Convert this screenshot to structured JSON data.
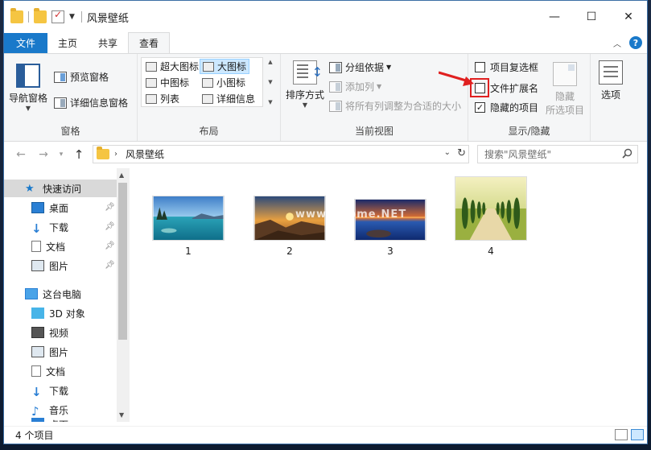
{
  "window": {
    "title": "风景壁纸",
    "controls": [
      "—",
      "☐",
      "✕"
    ]
  },
  "tabs": [
    {
      "label": "文件"
    },
    {
      "label": "主页"
    },
    {
      "label": "共享"
    },
    {
      "label": "查看"
    }
  ],
  "ribbon": {
    "panes": {
      "nav_pane": "导航窗格",
      "preview_pane": "预览窗格",
      "details_pane": "详细信息窗格",
      "group_label": "窗格"
    },
    "layout": {
      "items": [
        "超大图标",
        "大图标",
        "中图标",
        "小图标",
        "列表",
        "详细信息"
      ],
      "selected": "大图标",
      "group_label": "布局"
    },
    "current_view": {
      "sort_by": "排序方式",
      "group_by": "分组依据",
      "add_column": "添加列",
      "fit_columns": "将所有列调整为合适的大小",
      "group_label": "当前视图"
    },
    "show_hide": {
      "item_checkboxes": "项目复选框",
      "item_checkboxes_checked": false,
      "file_extensions": "文件扩展名",
      "file_extensions_checked": false,
      "hidden_items": "隐藏的项目",
      "hidden_items_checked": true,
      "hide_selected_line1": "隐藏",
      "hide_selected_line2": "所选项目",
      "group_label": "显示/隐藏"
    },
    "options": {
      "label": "选项"
    }
  },
  "address": {
    "path": "风景壁纸",
    "search_placeholder": "搜索\"风景壁纸\""
  },
  "nav_pane": {
    "quick_access": "快速访问",
    "quick_items": [
      {
        "label": "桌面",
        "pinned": true
      },
      {
        "label": "下载",
        "pinned": true
      },
      {
        "label": "文档",
        "pinned": true
      },
      {
        "label": "图片",
        "pinned": true
      }
    ],
    "this_pc": "这台电脑",
    "pc_items": [
      {
        "label": "3D 对象"
      },
      {
        "label": "视频"
      },
      {
        "label": "图片"
      },
      {
        "label": "文档"
      },
      {
        "label": "下载"
      },
      {
        "label": "音乐"
      },
      {
        "label": "桌面"
      }
    ]
  },
  "files": [
    {
      "name": "1",
      "theme": "lake"
    },
    {
      "name": "2",
      "theme": "sunset"
    },
    {
      "name": "3",
      "theme": "dusk-lake"
    },
    {
      "name": "4",
      "theme": "cypress-road"
    }
  ],
  "status": {
    "count": "4 个项目"
  },
  "watermark": "www.pHome.NET",
  "colors": {
    "accent": "#1979ca",
    "annotation_red": "#e02020"
  }
}
